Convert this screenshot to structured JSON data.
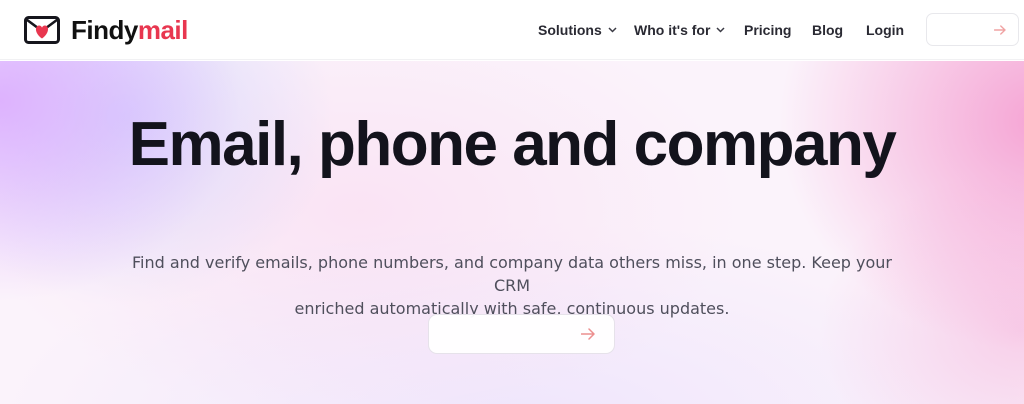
{
  "brand": {
    "name_part1": "Findy",
    "name_part2": "mail",
    "logo_icon": "envelope-heart-icon",
    "accent_color": "#e8364f"
  },
  "nav": {
    "items": [
      {
        "label": "Solutions",
        "has_dropdown": true
      },
      {
        "label": "Who it's for",
        "has_dropdown": true
      },
      {
        "label": "Pricing",
        "has_dropdown": false
      },
      {
        "label": "Blog",
        "has_dropdown": false
      },
      {
        "label": "Login",
        "has_dropdown": false
      }
    ],
    "cta_icon": "arrow-right-icon"
  },
  "hero": {
    "title": "Email, phone and company",
    "subtitle_line1": "Find and verify emails, phone numbers, and company data others miss, in one step. Keep your CRM",
    "subtitle_line2": "enriched automatically with safe, continuous updates.",
    "cta_icon": "arrow-right-icon"
  }
}
